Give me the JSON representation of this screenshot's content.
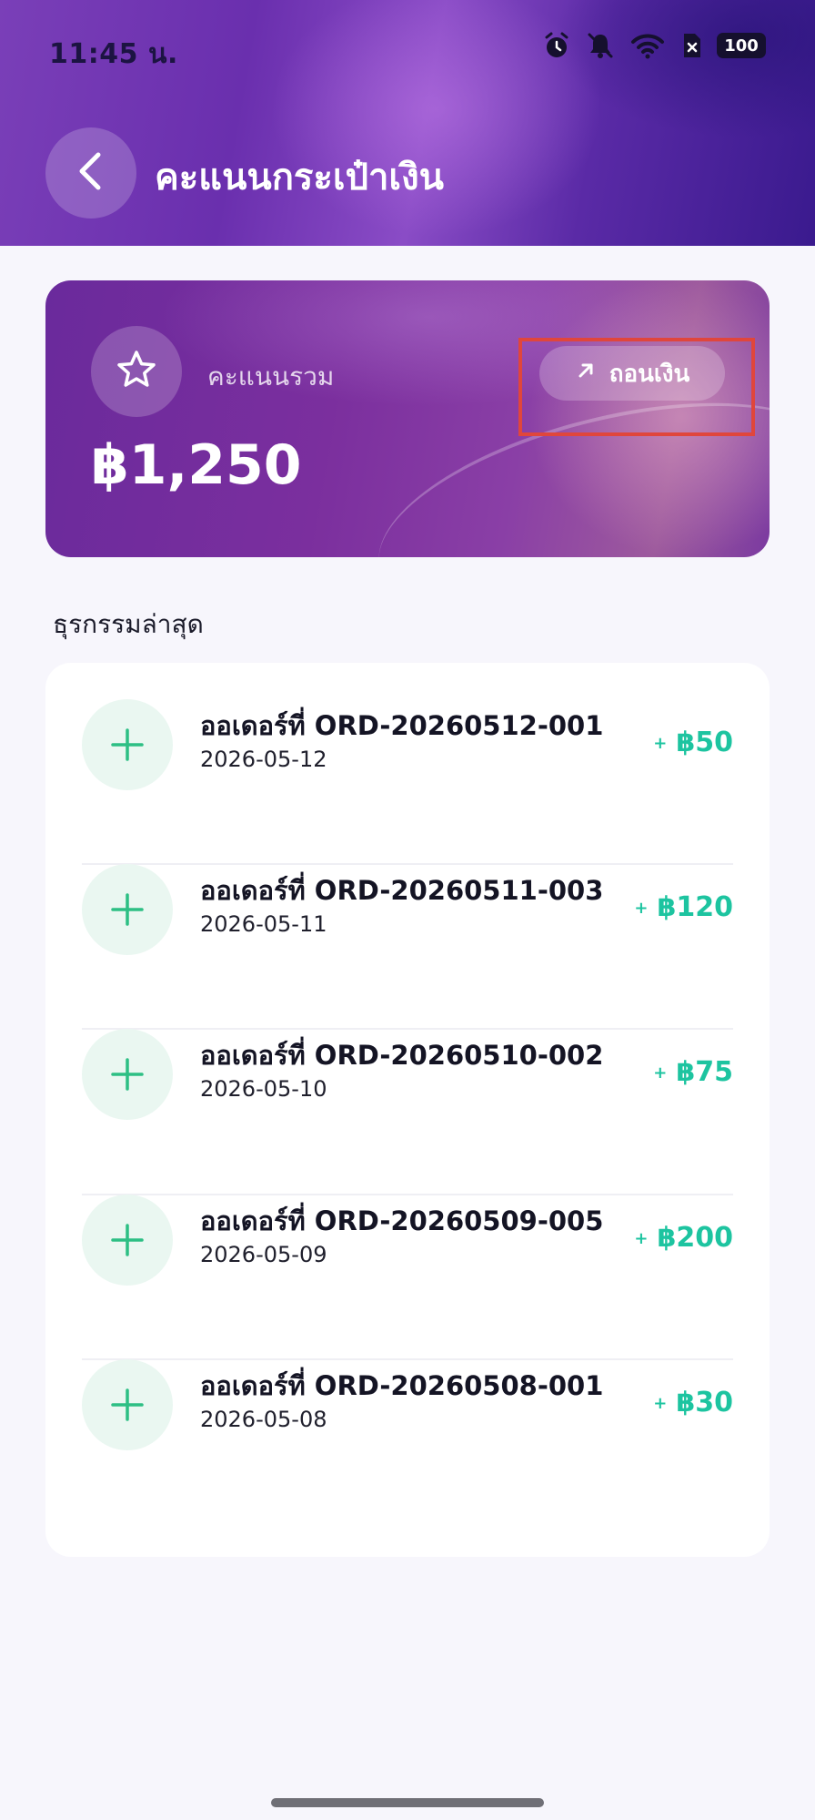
{
  "status_bar": {
    "time": "11:45 น.",
    "battery": "100",
    "icons": [
      "alarm-icon",
      "bell-off-icon",
      "wifi-icon",
      "sim-x-icon",
      "battery-icon"
    ]
  },
  "header": {
    "title": "คะแนนกระเป๋าเงิน",
    "back_icon": "chevron-left-icon"
  },
  "wallet": {
    "label": "คะแนนรวม",
    "value": "฿1,250",
    "star_icon": "star-icon",
    "withdraw_label": "ถอนเงิน",
    "withdraw_icon": "arrow-up-right-icon"
  },
  "transactions": {
    "section_title": "ธุรกรรมล่าสุด",
    "items": [
      {
        "title": "ออเดอร์ที่ ORD-20260512-001",
        "date": "2026-05-12",
        "sign": "+",
        "amount": "฿50"
      },
      {
        "title": "ออเดอร์ที่ ORD-20260511-003",
        "date": "2026-05-11",
        "sign": "+",
        "amount": "฿120"
      },
      {
        "title": "ออเดอร์ที่ ORD-20260510-002",
        "date": "2026-05-10",
        "sign": "+",
        "amount": "฿75"
      },
      {
        "title": "ออเดอร์ที่ ORD-20260509-005",
        "date": "2026-05-09",
        "sign": "+",
        "amount": "฿200"
      },
      {
        "title": "ออเดอร์ที่ ORD-20260508-001",
        "date": "2026-05-08",
        "sign": "+",
        "amount": "฿30"
      }
    ]
  },
  "colors": {
    "accent_purple": "#6a2fae",
    "amount_green": "#1dc4a0",
    "plus_green": "#2dbf84",
    "highlight_red": "#e0463c"
  }
}
